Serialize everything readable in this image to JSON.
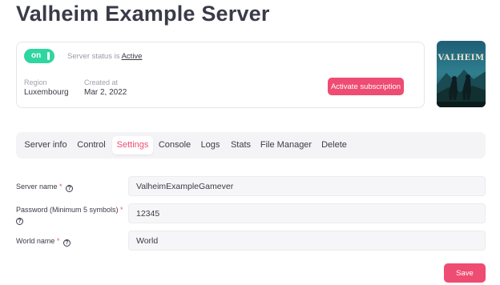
{
  "page": {
    "title": "Valheim Example Server"
  },
  "status_card": {
    "toggle_label": "on",
    "status_prefix": "Server status is ",
    "status_value": "Active",
    "region_label": "Region",
    "region_value": "Luxembourg",
    "created_label": "Created at",
    "created_value": "Mar 2, 2022",
    "activate_button": "Activate subscription"
  },
  "game_art": {
    "logo_text": "VALHEIM"
  },
  "tabs": [
    {
      "label": "Server info"
    },
    {
      "label": "Control"
    },
    {
      "label": "Settings",
      "active": true
    },
    {
      "label": "Console"
    },
    {
      "label": "Logs"
    },
    {
      "label": "Stats"
    },
    {
      "label": "File Manager"
    },
    {
      "label": "Delete"
    }
  ],
  "form": {
    "server_name": {
      "label": "Server name",
      "required_mark": "*",
      "value": "ValheimExampleGamever"
    },
    "password": {
      "label": "Password (Minimum 5 symbols)",
      "required_mark": "*",
      "value": "12345"
    },
    "world_name": {
      "label": "World name",
      "required_mark": "*",
      "value": "World"
    },
    "help_glyph": "?",
    "save_button": "Save"
  },
  "colors": {
    "accent": "#ee4c72",
    "toggle_on": "#2fd6a0",
    "text": "#3a3b48",
    "muted": "#9a9aa6"
  }
}
